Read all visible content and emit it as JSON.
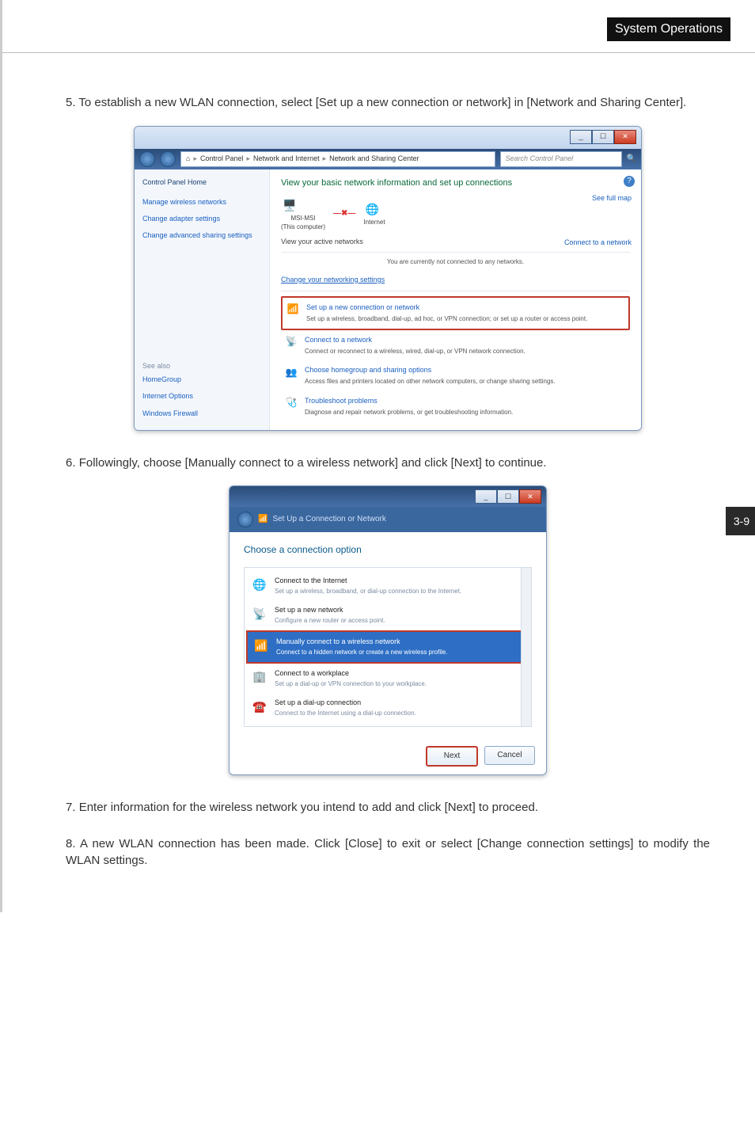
{
  "header": {
    "section_title": "System Operations"
  },
  "pageNumberTab": "3-9",
  "steps": {
    "s5": {
      "num": "5.",
      "text": "To establish a new WLAN connection, select [Set up a new connection or network] in [Network and Sharing Center]."
    },
    "s6": {
      "num": "6.",
      "text": "Followingly, choose [Manually connect to a wireless network] and click [Next] to continue."
    },
    "s7": {
      "num": "7.",
      "text": "Enter information for the wireless network you intend to add and click [Next] to proceed."
    },
    "s8": {
      "num": "8.",
      "text": "A new WLAN connection has been made. Click [Close] to exit or select [Change connection settings] to modify the WLAN settings."
    }
  },
  "win1": {
    "breadcrumb": {
      "root_icon": "⌂",
      "a": "Control Panel",
      "b": "Network and Internet",
      "c": "Network and Sharing Center"
    },
    "search_placeholder": "Search Control Panel",
    "sidebar": {
      "home": "Control Panel Home",
      "links": [
        "Manage wireless networks",
        "Change adapter settings",
        "Change advanced sharing settings"
      ],
      "see_also_hdr": "See also",
      "see_also": [
        "HomeGroup",
        "Internet Options",
        "Windows Firewall"
      ]
    },
    "main": {
      "title": "View your basic network information and set up connections",
      "full_map": "See full map",
      "node_a": "MSI-MSI",
      "node_a_sub": "(This computer)",
      "node_b": "Internet",
      "active_hdr": "View your active networks",
      "connect_link": "Connect to a network",
      "not_connected": "You are currently not connected to any networks.",
      "change_settings": "Change your networking settings",
      "tasks": [
        {
          "title": "Set up a new connection or network",
          "desc": "Set up a wireless, broadband, dial-up, ad hoc, or VPN connection; or set up a router or access point."
        },
        {
          "title": "Connect to a network",
          "desc": "Connect or reconnect to a wireless, wired, dial-up, or VPN network connection."
        },
        {
          "title": "Choose homegroup and sharing options",
          "desc": "Access files and printers located on other network computers, or change sharing settings."
        },
        {
          "title": "Troubleshoot problems",
          "desc": "Diagnose and repair network problems, or get troubleshooting information."
        }
      ]
    }
  },
  "win2": {
    "wizard_title": "Set Up a Connection or Network",
    "heading": "Choose a connection option",
    "options": [
      {
        "title": "Connect to the Internet",
        "desc": "Set up a wireless, broadband, or dial-up connection to the Internet."
      },
      {
        "title": "Set up a new network",
        "desc": "Configure a new router or access point."
      },
      {
        "title": "Manually connect to a wireless network",
        "desc": "Connect to a hidden network or create a new wireless profile."
      },
      {
        "title": "Connect to a workplace",
        "desc": "Set up a dial-up or VPN connection to your workplace."
      },
      {
        "title": "Set up a dial-up connection",
        "desc": "Connect to the Internet using a dial-up connection."
      }
    ],
    "buttons": {
      "next": "Next",
      "cancel": "Cancel"
    }
  }
}
